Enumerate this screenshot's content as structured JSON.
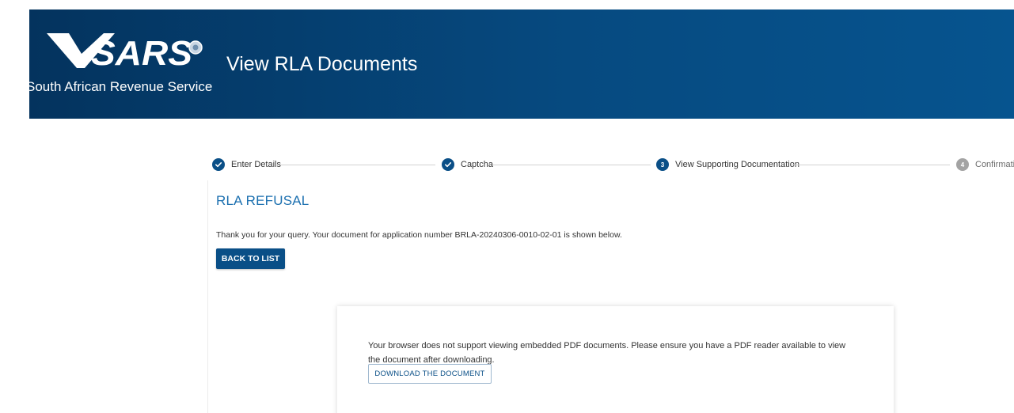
{
  "header": {
    "logo_text": "SARS",
    "logo_subtitle": "South African Revenue Service",
    "title": "View RLA Documents",
    "colors": {
      "header_start": "#04335e",
      "header_end": "#06548f"
    }
  },
  "stepper": {
    "steps": [
      {
        "label": "Enter Details",
        "status": "done",
        "icon": "check-icon"
      },
      {
        "label": "Captcha",
        "status": "done",
        "icon": "check-icon"
      },
      {
        "label": "View Supporting Documentation",
        "status": "active",
        "number": "3"
      },
      {
        "label": "Confirmatio",
        "status": "pending",
        "number": "4"
      }
    ],
    "colors": {
      "active": "#0a4f87",
      "pending": "#a3a3a3"
    }
  },
  "main": {
    "title": "RLA REFUSAL",
    "intro": "Thank you for your query. Your document for application number BRLA-20240306-0010-02-01 is shown below.",
    "back_button": "BACK TO LIST",
    "title_color": "#1c70b0"
  },
  "pdf_viewer": {
    "message_line1": "Your browser does not support viewing embedded PDF documents. Please ensure you have a PDF reader available to view",
    "message_line2": "the document after downloading.",
    "download_button": "DOWNLOAD THE DOCUMENT"
  }
}
